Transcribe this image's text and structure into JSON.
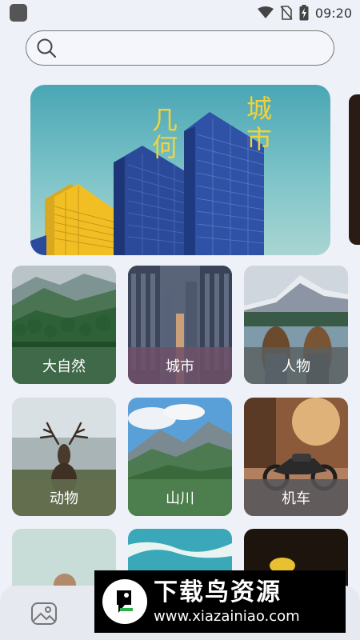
{
  "status_bar": {
    "time": "09:20",
    "icons": [
      "wifi-icon",
      "no-sim-icon",
      "battery-charging-icon"
    ]
  },
  "search": {
    "placeholder": "",
    "value": "",
    "icon": "search-icon"
  },
  "banner": {
    "chars_left": [
      "几",
      "何"
    ],
    "chars_right": [
      "城",
      "市"
    ]
  },
  "categories": [
    {
      "label": "大自然"
    },
    {
      "label": "城市"
    },
    {
      "label": "人物"
    },
    {
      "label": "动物"
    },
    {
      "label": "山川"
    },
    {
      "label": "机车"
    }
  ],
  "bottom_nav": {
    "icon": "gallery-icon"
  },
  "watermark": {
    "title": "下载鸟资源",
    "url": "www.xiazainiao.com"
  },
  "colors": {
    "background": "#eef1f8",
    "banner_text": "#f2d23a"
  }
}
